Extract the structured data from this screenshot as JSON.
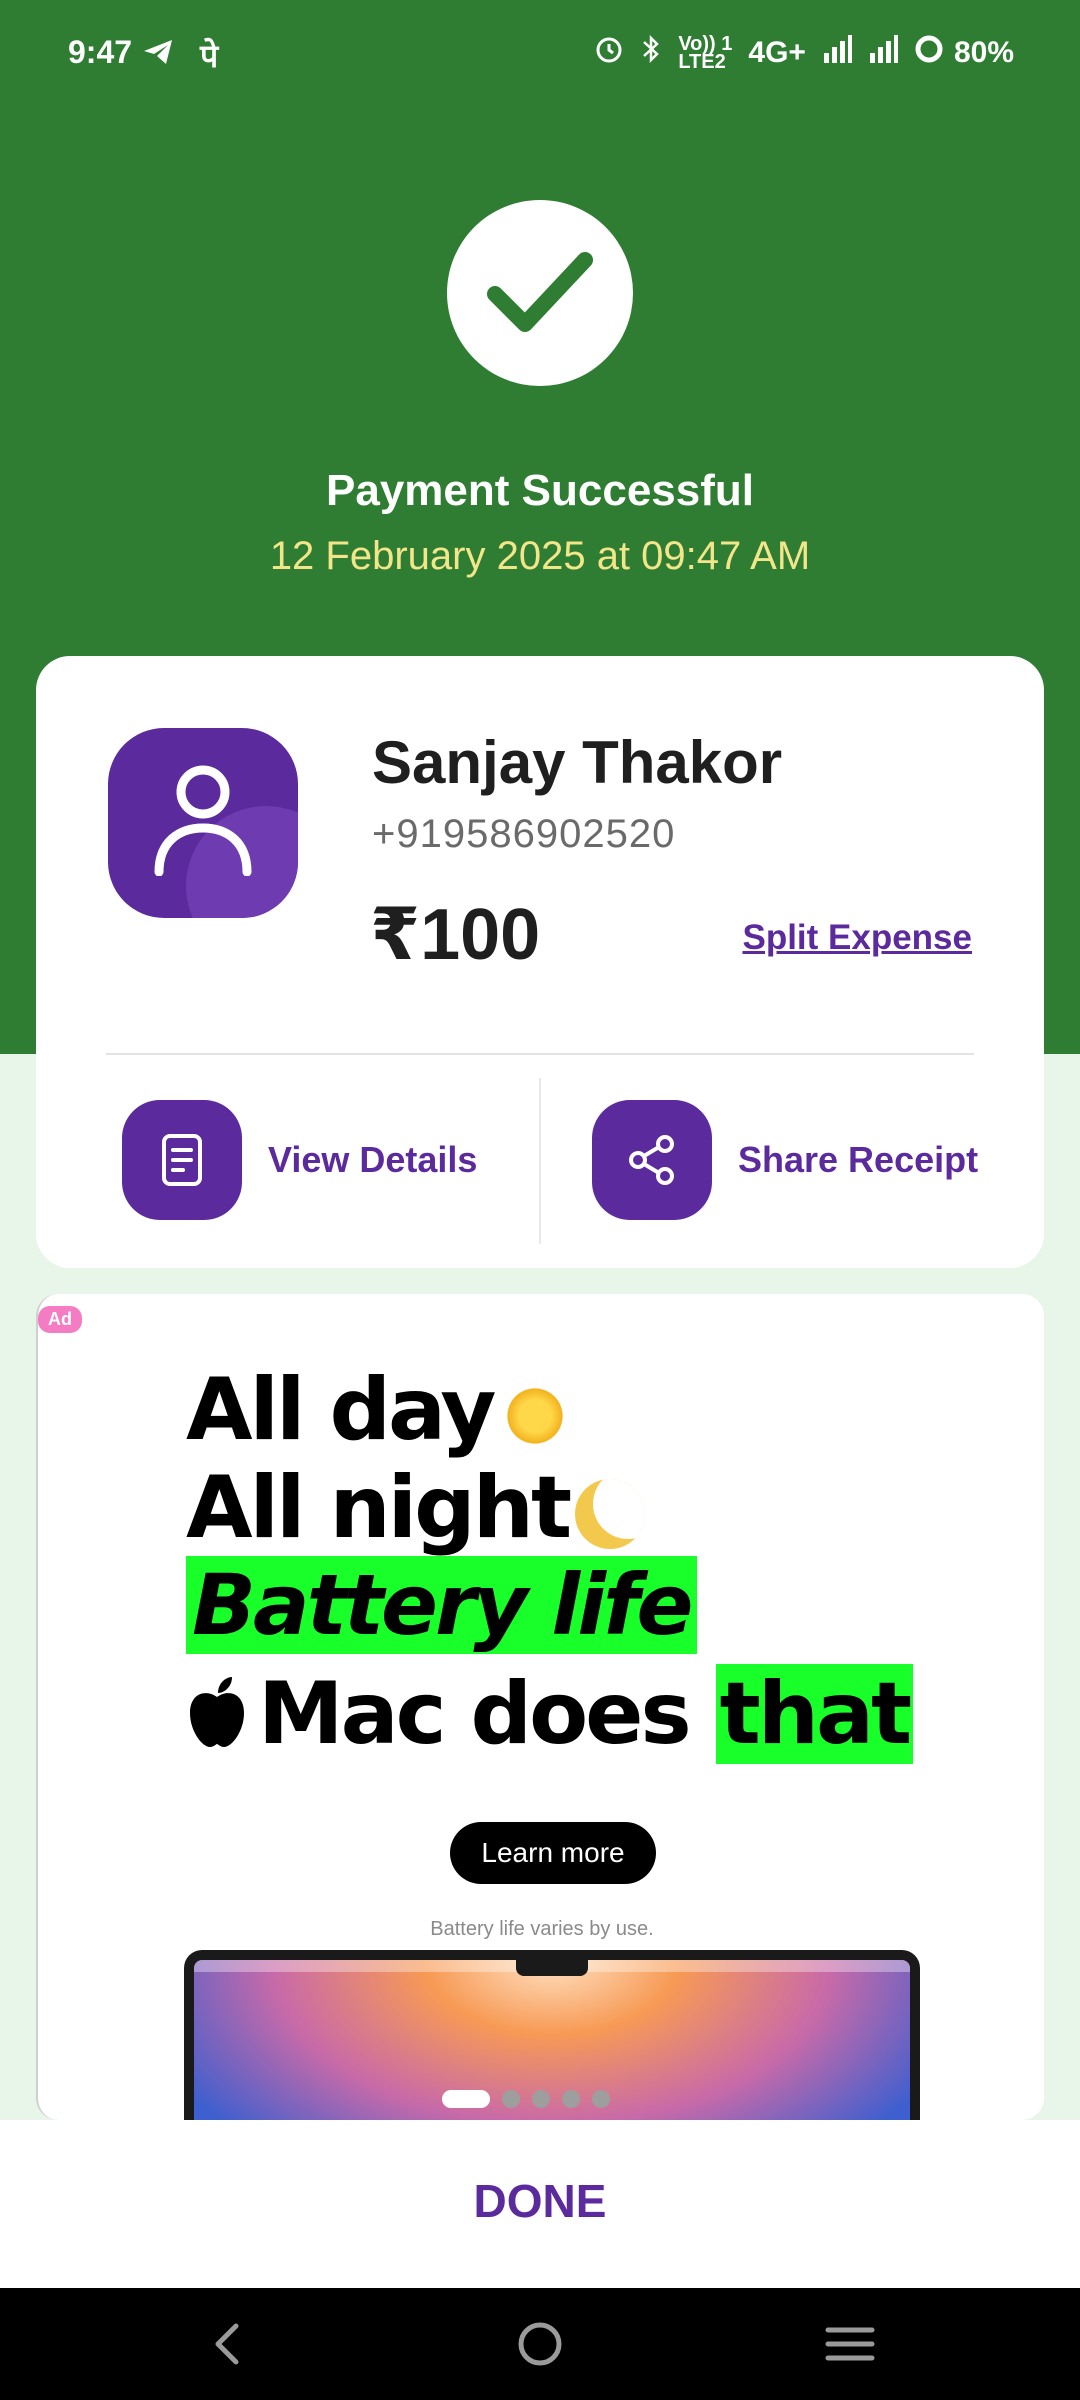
{
  "status_bar": {
    "time": "9:47",
    "left_icons": [
      "telegram-icon",
      "pe-icon"
    ],
    "pe_glyph": "पे",
    "volte_top": "Vo)) 1",
    "volte_bottom": "LTE2",
    "network": "4G+",
    "battery": "80%"
  },
  "payment": {
    "title": "Payment Successful",
    "date": "12 February 2025 at 09:47 AM",
    "status_color": "#2f7d32"
  },
  "recipient": {
    "name": "Sanjay Thakor",
    "phone": "+919586902520",
    "amount": "₹100",
    "split_label": "Split Expense"
  },
  "actions": {
    "view_details": "View Details",
    "share_receipt": "Share Receipt"
  },
  "ad": {
    "badge": "Ad",
    "line1": "All day",
    "line2": "All night",
    "line3": "Battery life",
    "line4_main": "Mac does ",
    "line4_highlight": "that",
    "cta": "Learn more",
    "note": "Battery life varies by use.",
    "carousel_count": 5,
    "carousel_active": 0
  },
  "done_label": "DONE",
  "theme": {
    "accent": "#5b2a9d",
    "header": "#2f7d32",
    "date_color": "#f3e58a",
    "highlight": "#19ff2a"
  }
}
